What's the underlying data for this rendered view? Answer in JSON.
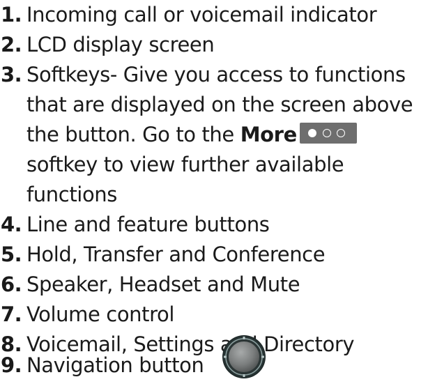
{
  "items": [
    {
      "number": "1.",
      "text": "Incoming call or voicemail indicator"
    },
    {
      "number": "2.",
      "text": "LCD display screen"
    },
    {
      "number": "3.",
      "text_line1": "Softkeys- Give you access to functions",
      "text_line2": "that are displayed on the screen above",
      "text_line3_pre": "the button. Go to the ",
      "text_line3_bold": "More",
      "text_line4": "softkey to view further available",
      "text_line5": "functions"
    },
    {
      "number": "4.",
      "text": "Line and feature buttons"
    },
    {
      "number": "5.",
      "text": "Hold, Transfer and Conference"
    },
    {
      "number": "6.",
      "text": "Speaker, Headset and Mute"
    },
    {
      "number": "7.",
      "text": "Volume control"
    },
    {
      "number": "8.",
      "text": "Voicemail, Settings and Directory"
    },
    {
      "number": "9.",
      "text": "Navigation button"
    }
  ],
  "colors": {
    "text": "#1a1a1a",
    "softkey_background": "#6e6e6e",
    "softkey_dot": "#ffffff",
    "nav_ring_outer": "#2a3a3a",
    "nav_center": "#7a7d7d"
  },
  "icons": {
    "more_softkey": "more-softkey-icon",
    "navigation": "navigation-button-icon"
  }
}
